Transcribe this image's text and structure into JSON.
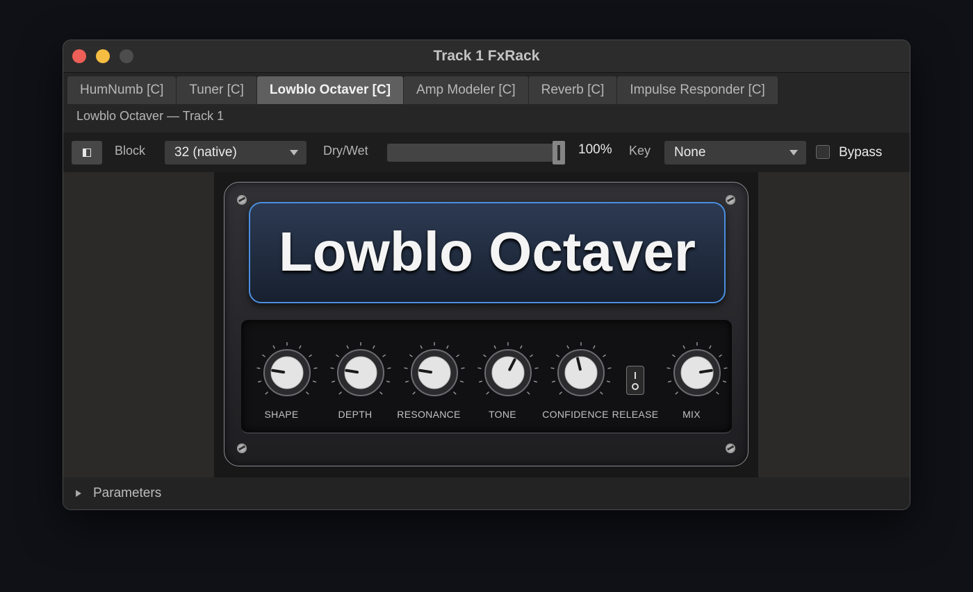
{
  "window": {
    "title": "Track 1 FxRack"
  },
  "tabs": [
    {
      "label": "HumNumb [C]",
      "active": false
    },
    {
      "label": "Tuner [C]",
      "active": false
    },
    {
      "label": "Lowblo Octaver [C]",
      "active": true
    },
    {
      "label": "Amp Modeler [C]",
      "active": false
    },
    {
      "label": "Reverb [C]",
      "active": false
    },
    {
      "label": "Impulse Responder [C]",
      "active": false
    }
  ],
  "subtitle": "Lowblo Octaver — Track 1",
  "toolbar": {
    "block_label": "Block",
    "block_value": "32 (native)",
    "drywet_label": "Dry/Wet",
    "drywet_value": 100,
    "drywet_text": "100%",
    "key_label": "Key",
    "key_value": "None",
    "bypass_label": "Bypass",
    "bypass_checked": false
  },
  "plugin": {
    "name": "Lowblo Octaver",
    "controls": [
      {
        "label": "SHAPE",
        "kind": "knob",
        "value": 0.2
      },
      {
        "label": "DEPTH",
        "kind": "knob",
        "value": 0.2
      },
      {
        "label": "RESONANCE",
        "kind": "knob",
        "value": 0.2
      },
      {
        "label": "TONE",
        "kind": "knob",
        "value": 0.6
      },
      {
        "label": "CONFIDENCE",
        "kind": "knob",
        "value": 0.45
      },
      {
        "label": "RELEASE",
        "kind": "switch",
        "value": 1
      },
      {
        "label": "MIX",
        "kind": "knob",
        "value": 0.8
      }
    ],
    "accent_color": "#4b8fe0"
  },
  "footer": {
    "label": "Parameters"
  }
}
